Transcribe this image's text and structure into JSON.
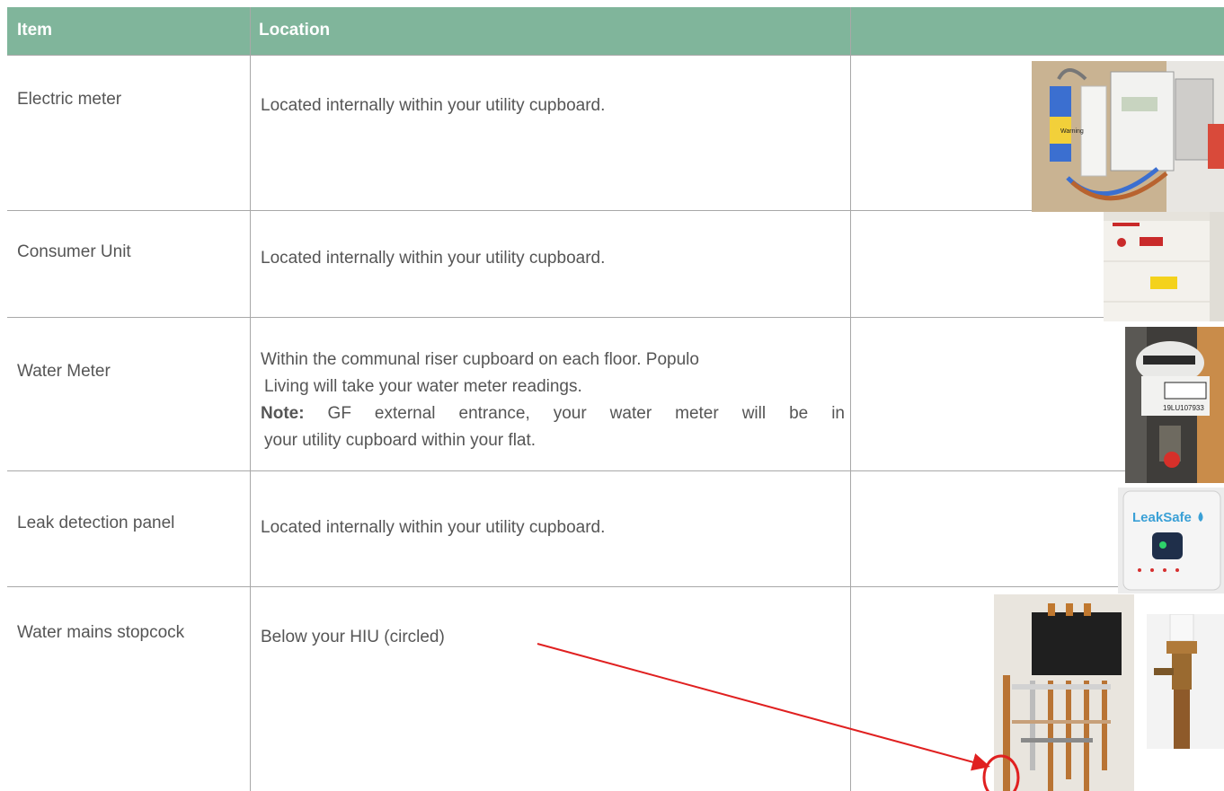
{
  "header": {
    "item": "Item",
    "location": "Location"
  },
  "rows": [
    {
      "item": "Electric meter",
      "location": "Located internally within your utility cupboard."
    },
    {
      "item": "Consumer Unit",
      "location": "Located internally within your utility cupboard."
    },
    {
      "item": "Water Meter",
      "location_line1": "Within the communal riser cupboard on each floor. Populo",
      "location_line2": "Living will take your water meter readings.",
      "note_label": "Note:",
      "note_line1": " GF external entrance, your water meter will be in",
      "note_line2": "your utility cupboard within your flat."
    },
    {
      "item": "Leak detection panel",
      "location": "Located internally within your utility cupboard."
    },
    {
      "item": "Water mains stopcock",
      "location": "Below your HIU (circled)"
    }
  ],
  "photos": {
    "leaksafe_logo": "LeakSafe",
    "water_meter_serial": "19LU107933",
    "electric_warning": "Warning"
  },
  "colors": {
    "header_bg": "#80b59b",
    "border": "#a8a8a8",
    "annotation": "#e02020"
  }
}
